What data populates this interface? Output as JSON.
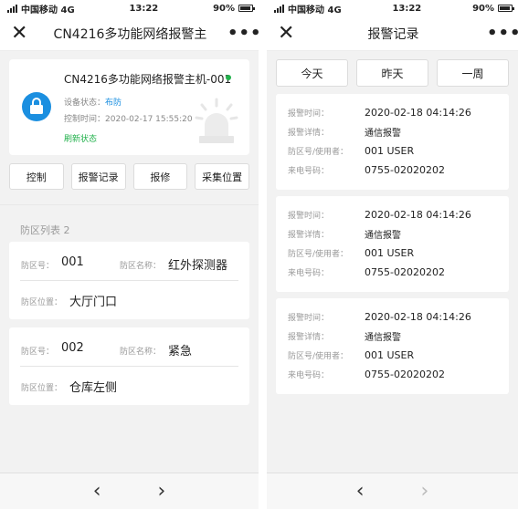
{
  "status_bar": {
    "carrier": "中国移动 4G",
    "time": "13:22",
    "battery": "90%"
  },
  "left_screen": {
    "nav_title": "CN4216多功能网络报警主",
    "device": {
      "name": "CN4216多功能网络报警主机-001",
      "status_label": "设备状态：",
      "status_value": "布防",
      "control_time_label": "控制时间：",
      "control_time_value": "2020-02-17  15:55:20",
      "refresh_label": "刷新状态"
    },
    "actions": [
      "控制",
      "报警记录",
      "报修",
      "采集位置"
    ],
    "zone_list_title": "防区列表 2",
    "zones": [
      {
        "number_label": "防区号：",
        "number": "001",
        "name_label": "防区名称：",
        "name": "红外探测器",
        "location_label": "防区位置：",
        "location": "大厅门口"
      },
      {
        "number_label": "防区号：",
        "number": "002",
        "name_label": "防区名称：",
        "name": "紧急",
        "location_label": "防区位置：",
        "location": "仓库左侧"
      }
    ]
  },
  "right_screen": {
    "nav_title": "报警记录",
    "date_tabs": [
      "今天",
      "昨天",
      "一周"
    ],
    "records": [
      {
        "time_label": "报警时间：",
        "time": "2020-02-18  04:14:26",
        "detail_label": "报警详情：",
        "detail": "通信报警",
        "zone_user_label": "防区号/使用者：",
        "zone_user": "001 USER",
        "phone_label": "来电号码：",
        "phone": "0755-02020202"
      },
      {
        "time_label": "报警时间：",
        "time": "2020-02-18  04:14:26",
        "detail_label": "报警详情：",
        "detail": "通信报警",
        "zone_user_label": "防区号/使用者：",
        "zone_user": "001 USER",
        "phone_label": "来电号码：",
        "phone": "0755-02020202"
      },
      {
        "time_label": "报警时间：",
        "time": "2020-02-18  04:14:26",
        "detail_label": "报警详情：",
        "detail": "通信报警",
        "zone_user_label": "防区号/使用者：",
        "zone_user": "001 USER",
        "phone_label": "来电号码：",
        "phone": "0755-02020202"
      }
    ]
  },
  "colors": {
    "accent_blue": "#1b8fe0",
    "online_green": "#22b14c",
    "background": "#f2f2f2"
  },
  "icons": [
    "close-icon",
    "more-icon",
    "lock-icon",
    "alarm-light-icon",
    "online-dot-icon",
    "chevron-left-icon",
    "chevron-right-icon"
  ]
}
